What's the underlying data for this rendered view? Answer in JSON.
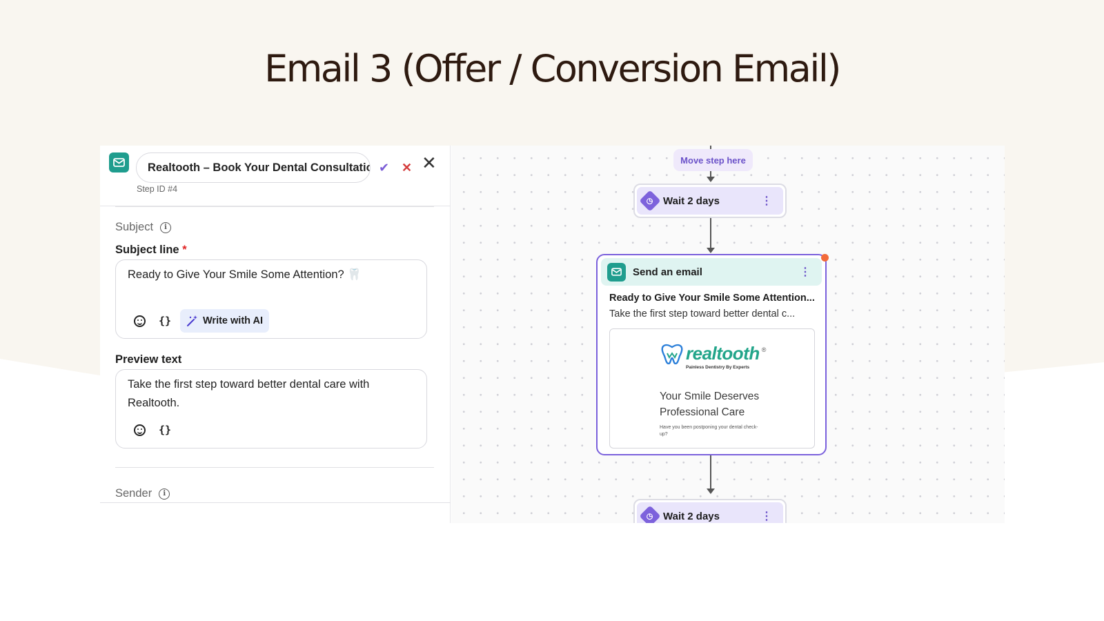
{
  "slide": {
    "title": "Email 3 (Offer / Conversion Email)"
  },
  "colors": {
    "background_top": "#f9f6f0",
    "title_text": "#2e1a10",
    "accent_purple": "#7a60dc",
    "teal": "#1f9d8e",
    "required": "#e02424"
  },
  "panel": {
    "step_name": "Realtooth – Book Your Dental Consultation",
    "step_id": "Step ID #4",
    "icons": {
      "step": "mail-icon",
      "confirm": "check-icon",
      "cancel": "x-icon",
      "close": "close-icon"
    },
    "subject_section": "Subject",
    "subject_line_label": "Subject line",
    "required_mark": "*",
    "subject_value": "Ready to Give Your Smile Some Attention? 🦷",
    "write_ai_label": "Write with AI",
    "preview_label": "Preview text",
    "preview_value": "Take the first step toward better dental care with Realtooth.",
    "sender_section": "Sender"
  },
  "canvas": {
    "move_step": "Move step here",
    "wait1": "Wait 2 days",
    "wait2": "Wait 2 days",
    "email_node": {
      "title": "Send an email",
      "subject": "Ready to Give Your Smile Some Attention...",
      "preview": "Take the first step toward better dental c...",
      "brand": "realtooth",
      "brand_mark": "®",
      "brand_tagline": "Painless Dentistry By Experts",
      "thumb_heading": "Your Smile Deserves Professional Care",
      "thumb_body": "Have you been postponing your dental check-up?"
    }
  }
}
